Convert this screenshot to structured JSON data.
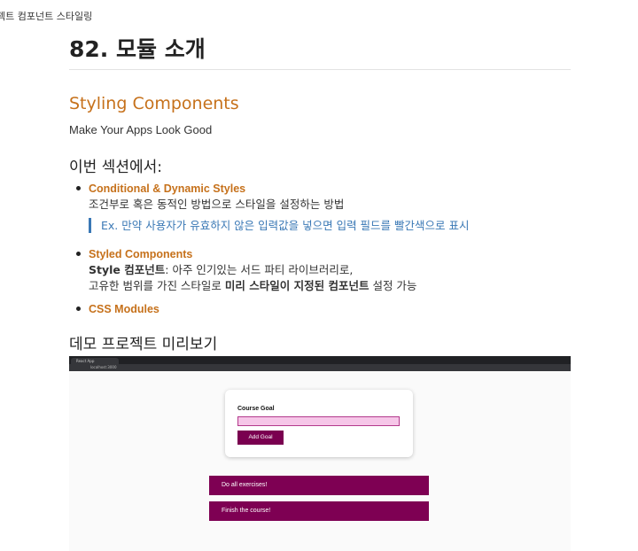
{
  "breadcrumb": "젝트 컴포넌트 스타일링",
  "title": "82. 모듈 소개",
  "section_title": "Styling Components",
  "subtitle": "Make Your Apps Look Good",
  "heading_in_section": "이번 섹션에서:",
  "items": [
    {
      "title": "Conditional & Dynamic Styles",
      "desc": "조건부로 혹은 동적인 방법으로 스타일을 설정하는 방법",
      "quote": "Ex. 만약 사용자가 유효하지 않은 입력값을 넣으면 입력 필드를 빨간색으로 표시"
    },
    {
      "title": "Styled Components",
      "desc_line1_a": "Style ",
      "desc_line1_b": "컴포넌트",
      "desc_line1_c": ": 아주 인기있는 서드 파티 라이브러리로,",
      "desc_line2_a": "고유한 범위를 가진 스타일로 ",
      "desc_line2_b": "미리 스타일이 지정된 컴포넌트",
      "desc_line2_c": " 설정 가능"
    },
    {
      "title": "CSS Modules"
    }
  ],
  "demo_heading": "데모 프로젝트 미리보기",
  "demo": {
    "tab_label": "React App",
    "url": "localhost:3000",
    "card_label": "Course Goal",
    "add_button": "Add Goal",
    "goals": [
      "Do all exercises!",
      "Finish the course!"
    ],
    "colors": {
      "button": "#7a0050",
      "goal_bg": "#7e0053",
      "input_bg": "#f6c6e8"
    }
  },
  "colors": {
    "accent": "#c6711b",
    "quote": "#3a78b5"
  }
}
